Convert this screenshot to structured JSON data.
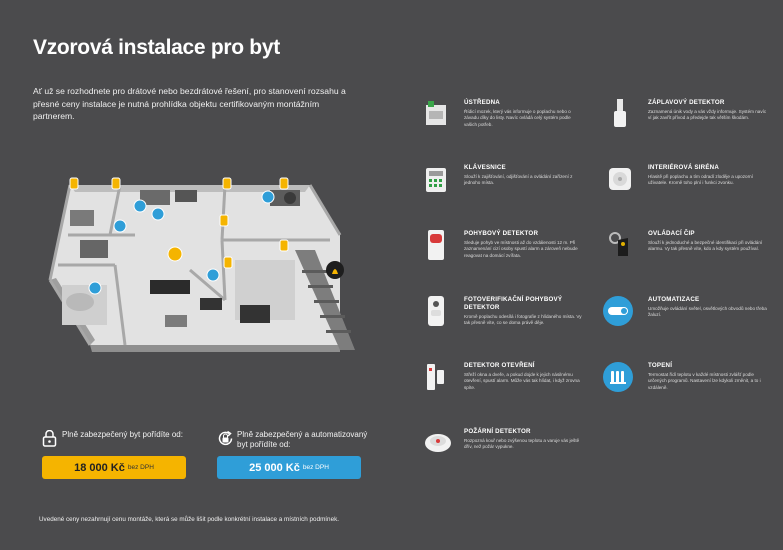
{
  "title": "Vzorová instalace pro byt",
  "intro": "Ať už se rozhodnete pro drátové nebo bezdrátové řešení, pro stanovení rozsahu a přesné ceny instalace je nutná prohlídka objektu certifikovaným montážním partnerem.",
  "features": [
    {
      "title": "ÚSTŘEDNA",
      "desc": "Řídicí mozek, který vás informuje o poplachu nebo o závadu díky do listy. Navíc ovládá celý systém podle vašich potřeb.",
      "icon": "control-panel-icon"
    },
    {
      "title": "ZÁPLAVOVÝ DETEKTOR",
      "desc": "Zaznamená únik vody a vás vždy informuje. Systém navíc ví jak zavřít přívod a předejde tak větším škodám.",
      "icon": "flood-detector-icon"
    },
    {
      "title": "KLÁVESNICE",
      "desc": "Slouží k zajišťování, odjišťování a ovládání zařízení z jednoho místa.",
      "icon": "keypad-icon"
    },
    {
      "title": "INTERIÉROVÁ SIRÉNA",
      "desc": "Hlasitě při poplachu a tím odradí zloděje a upozorní uživatele. Kromě toho plní i funkci zvonku.",
      "icon": "siren-icon"
    },
    {
      "title": "POHYBOVÝ DETEKTOR",
      "desc": "Sleduje pohyb ve místnosti až do vzdálenosti 12 m. Při zaznamenání cizí osoby spustí alarm a zároveň nebude reagovat na domácí zvířata.",
      "icon": "motion-detector-icon"
    },
    {
      "title": "OVLÁDACÍ ČIP",
      "desc": "Slouží k jednoduché a bezpečné identifikaci při ovládání alarmu. Vy tak přesně víte, kdo a kdy systém používal.",
      "icon": "key-fob-icon"
    },
    {
      "title": "FOTOVERIFIKAČNÍ POHYBOVÝ DETEKTOR",
      "desc": "Kromě poplachu odesílá i fotografie z hlídaného místa. Vy tak přesně víte, co se doma právě děje.",
      "icon": "camera-detector-icon"
    },
    {
      "title": "AUTOMATIZACE",
      "desc": "Umožňuje ovládání světel, osvětlových obvodů nebo třeba žaluzí.",
      "icon": "automation-toggle-icon"
    },
    {
      "title": "DETEKTOR OTEVŘENÍ",
      "desc": "Střeží okna a dveře, a pokud dojde k jejich násilnému otevření, spustí alarm. Může vás tak hlídat, i když zrovna spíte.",
      "icon": "door-sensor-icon"
    },
    {
      "title": "TOPENÍ",
      "desc": "Termostat řídí teplotu v každé místnosti zvlášť podle určených programů. Nastavení lze kdykoli změnit, a to i vzdáleně.",
      "icon": "heating-icon"
    },
    {
      "title": "POŽÁRNÍ DETEKTOR",
      "desc": "Rozpozná kouř nebo zvýšenou teplotu a varuje vás ještě dřív, než požár vypukne.",
      "icon": "smoke-detector-icon"
    }
  ],
  "prices": [
    {
      "label": "Plně zabezpečený byt pořídíte od:",
      "value": "18 000 Kč",
      "unit": "bez DPH",
      "icon": "lock-icon",
      "color": "#f5b400"
    },
    {
      "label": "Plně zabezpečený a automatizovaný byt pořídíte od:",
      "value": "25 000 Kč",
      "unit": "bez DPH",
      "icon": "refresh-lock-icon",
      "color": "#2f9ed8"
    }
  ],
  "footnote": "Uvedené ceny nezahrnují cenu montáže, která se může lišit podle konkrétní instalace a místních podmínek."
}
